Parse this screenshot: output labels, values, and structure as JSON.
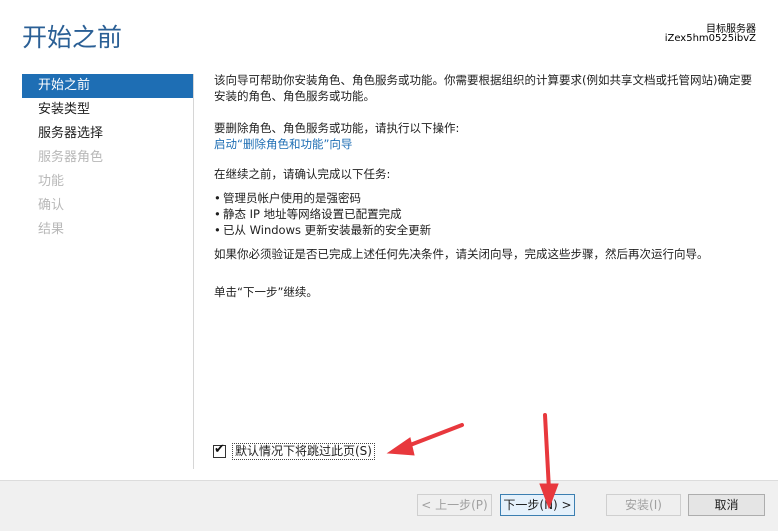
{
  "header": {
    "title": "开始之前",
    "target_label": "目标服务器",
    "target_server": "iZex5hm0525ibvZ"
  },
  "nav": {
    "items": [
      {
        "label": "开始之前",
        "state": "active"
      },
      {
        "label": "安装类型",
        "state": "enabled"
      },
      {
        "label": "服务器选择",
        "state": "enabled"
      },
      {
        "label": "服务器角色",
        "state": "disabled"
      },
      {
        "label": "功能",
        "state": "disabled"
      },
      {
        "label": "确认",
        "state": "disabled"
      },
      {
        "label": "结果",
        "state": "disabled"
      }
    ]
  },
  "content": {
    "intro": "该向导可帮助你安装角色、角色服务或功能。你需要根据组织的计算要求(例如共享文档或托管网站)确定要安装的角色、角色服务或功能。",
    "remove_text": "要删除角色、角色服务或功能，请执行以下操作:",
    "remove_link": "启动“删除角色和功能”向导",
    "before_text": "在继续之前，请确认完成以下任务:",
    "bullets": [
      "管理员帐户使用的是强密码",
      "静态 IP 地址等网络设置已配置完成",
      "已从 Windows 更新安装最新的安全更新"
    ],
    "verify_text": "如果你必须验证是否已完成上述任何先决条件，请关闭向导，完成这些步骤，然后再次运行向导。",
    "click_text": "单击“下一步”继续。"
  },
  "skip": {
    "label": "默认情况下将跳过此页(S)",
    "checked": true
  },
  "buttons": {
    "prev": "< 上一步(P)",
    "next": "下一步(N) >",
    "install": "安装(I)",
    "cancel": "取消"
  },
  "bullet_glyph": "•",
  "colors": {
    "title": "#2a5f95",
    "nav_active": "#1e6eb4",
    "link": "#1e6eb4",
    "annotation_arrow": "#e8383d"
  }
}
